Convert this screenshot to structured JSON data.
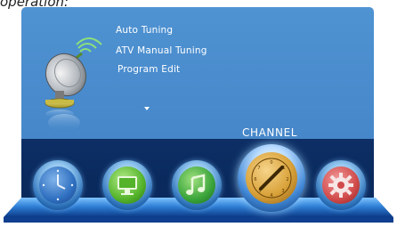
{
  "caption": "operation:",
  "menu": {
    "items": [
      {
        "label": "Auto Tuning"
      },
      {
        "label": "ATV Manual Tuning"
      },
      {
        "label": "Program Edit"
      }
    ],
    "section_title": "CHANNEL"
  },
  "dock": {
    "icons": [
      {
        "name": "clock-icon",
        "color": "#2f6fc0",
        "selected": false
      },
      {
        "name": "picture-icon",
        "color": "#54b32a",
        "selected": false
      },
      {
        "name": "music-icon",
        "color": "#3aa43a",
        "selected": false
      },
      {
        "name": "channel-dial-icon",
        "color": "#d9a23a",
        "selected": true
      },
      {
        "name": "settings-icon",
        "color": "#d04a4a",
        "selected": false
      }
    ]
  },
  "colors": {
    "panel": "#4a8ccd",
    "dock": "#0a2a5d",
    "text": "#ffffff"
  }
}
